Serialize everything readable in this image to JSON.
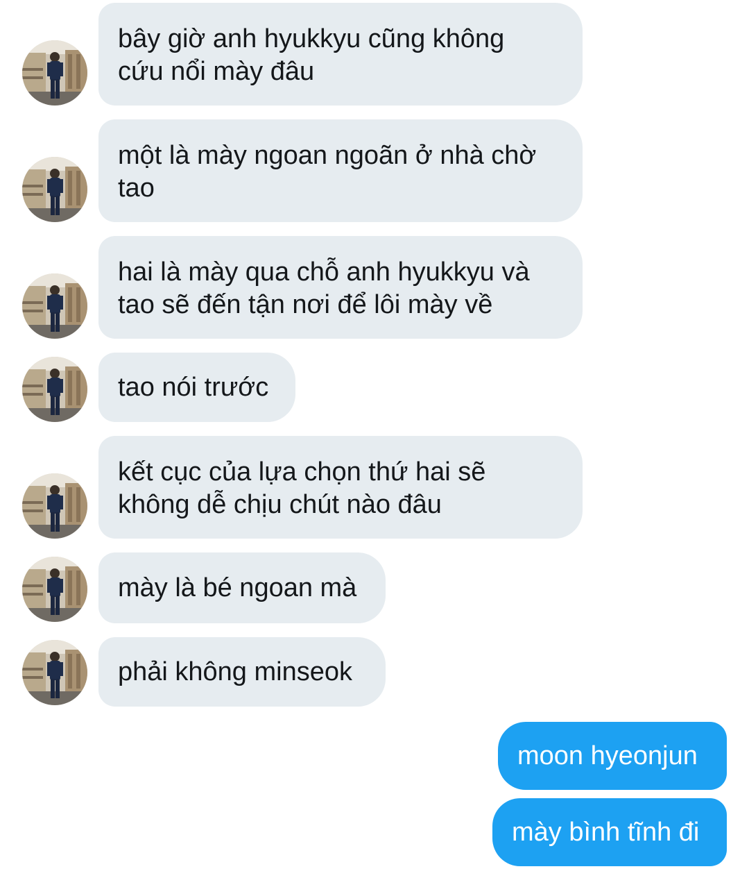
{
  "conversation": {
    "incoming": [
      {
        "text": "bây giờ anh hyukkyu cũng không\ncứu nổi mày đâu"
      },
      {
        "text": "một là mày ngoan ngoãn ở nhà chờ\ntao"
      },
      {
        "text": "hai là mày qua chỗ anh hyukkyu và\ntao sẽ đến tận nơi để lôi mày về"
      },
      {
        "text": "tao nói trước"
      },
      {
        "text": "kết cục của lựa chọn thứ hai sẽ\nkhông dễ chịu chút nào đâu"
      },
      {
        "text": "mày là bé ngoan mà"
      },
      {
        "text": "phải không minseok"
      }
    ],
    "outgoing": [
      {
        "text": "moon hyeonjun"
      },
      {
        "text": "mày bình tĩnh đi"
      }
    ]
  },
  "colors": {
    "incoming_bubble": "#e6ecf0",
    "outgoing_bubble": "#1da1f2",
    "incoming_text": "#14171a",
    "outgoing_text": "#ffffff"
  }
}
